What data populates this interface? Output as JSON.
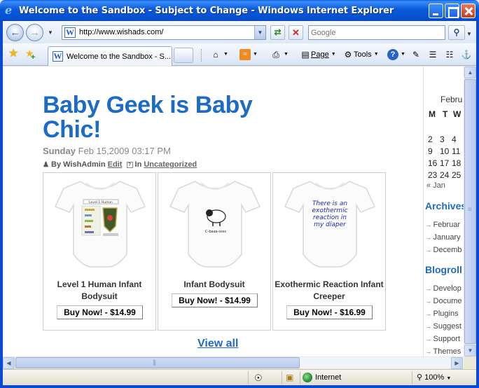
{
  "window": {
    "title": "Welcome to the Sandbox - Subject to Change - Windows Internet Explorer"
  },
  "navbar": {
    "url": "http://www.wishads.com/",
    "search_placeholder": "Google"
  },
  "tabbar": {
    "tab_label": "Welcome to the Sandbox - S..."
  },
  "commands": {
    "page": "Page",
    "tools": "Tools"
  },
  "post": {
    "title": "Baby Geek is Baby Chic!",
    "weekday": "Sunday",
    "date": "Feb 15,2009 03:17 PM",
    "by_label": "By WishAdmin",
    "edit": "Edit",
    "in_label": "In",
    "category": "Uncategorized"
  },
  "products": [
    {
      "name": "Level 1 Human Infant Bodysuit",
      "buy": "Buy Now! - $14.99",
      "print": "Level 1 Human"
    },
    {
      "name": "Infant Bodysuit",
      "buy": "Buy Now! - $14.99",
      "print": "C-baaa-ssss"
    },
    {
      "name": "Exothermic Reaction Infant Creeper",
      "buy": "Buy Now! - $16.99",
      "print_lines": [
        "There is an",
        "exothermic",
        "reaction in",
        "my diaper"
      ]
    }
  ],
  "view_all": "View all",
  "sidebar": {
    "calendar": {
      "month": "Febru",
      "headers": [
        "M",
        "T",
        "W"
      ],
      "rows": [
        [
          "",
          "",
          ""
        ],
        [
          "2",
          "3",
          "4"
        ],
        [
          "9",
          "10",
          "11"
        ],
        [
          "16",
          "17",
          "18"
        ],
        [
          "23",
          "24",
          "25"
        ]
      ],
      "prev": "« Jan"
    },
    "archives_title": "Archives",
    "archives": [
      "Februar",
      "January",
      "Decemb"
    ],
    "blogroll_title": "Blogroll",
    "blogroll": [
      "Develop",
      "Docume",
      "Plugins",
      "Suggest",
      "Support",
      "Themes"
    ]
  },
  "status": {
    "zone": "Internet",
    "zoom": "100%"
  },
  "colors": {
    "accent": "#1d6bc4",
    "titlebar": "#0a58d8"
  }
}
